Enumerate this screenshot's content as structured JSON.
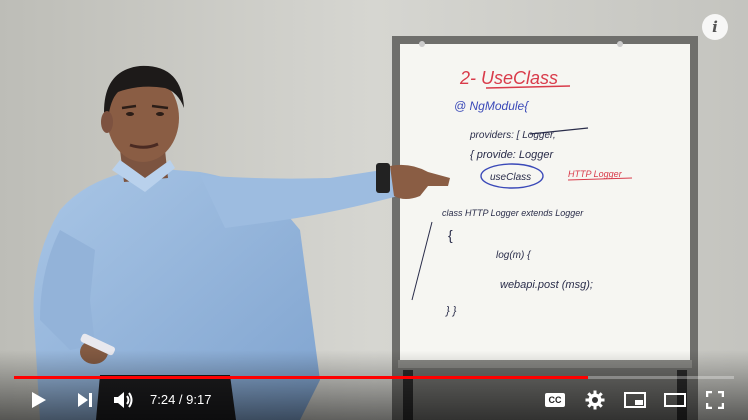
{
  "video": {
    "current_time": "7:24",
    "duration": "9:17",
    "time_separator": " / ",
    "progress_fraction": 0.797,
    "buffered_fraction": 0.79
  },
  "controls": {
    "play_icon": "play-icon",
    "next_icon": "next-icon",
    "volume_icon": "volume-icon",
    "captions_icon": "cc-icon",
    "settings_icon": "gear-icon",
    "miniplayer_icon": "miniplayer-icon",
    "theater_icon": "theater-icon",
    "fullscreen_icon": "fullscreen-icon",
    "info_icon": "info-icon",
    "cc_label": "CC",
    "info_label": "i"
  },
  "whiteboard": {
    "title": "2- UseClass",
    "line1": "@ NgModule{",
    "line2": "providers: [ Logger,",
    "line3": "{ provide: Logger",
    "line4a": "useClass",
    "line4b": "HTTP Logger",
    "line5": "class   HTTP Logger  extends Logger",
    "line6": "{",
    "line7": "log(m) {",
    "line8": "webapi.post (msg);",
    "line9": "} }"
  },
  "colors": {
    "accent": "#ff0000",
    "marker_red": "#d93b4a",
    "marker_blue": "#3a49b8",
    "marker_dark": "#2a2d4a"
  }
}
